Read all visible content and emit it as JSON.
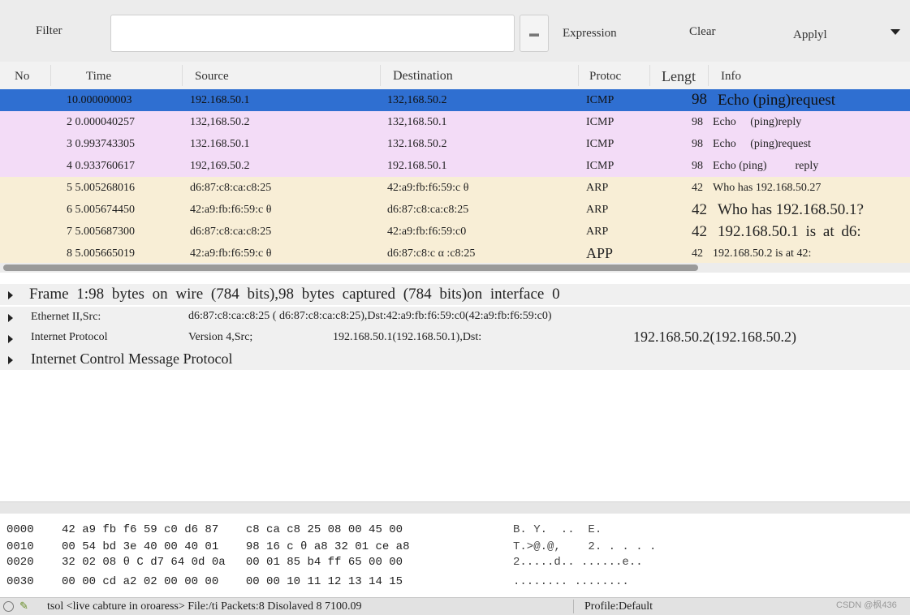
{
  "toolbar": {
    "filter_label": "Filter",
    "filter_value": "",
    "dropdown_glyph": "▬",
    "expression_label": "Expression",
    "clear_label": "Clear",
    "apply_label": "Applyl"
  },
  "columns": {
    "no": "No",
    "time": "Time",
    "source": "Source",
    "destination": "Destination",
    "protocol": "Protoc",
    "length": "Lengt",
    "info": "Info"
  },
  "packets": [
    {
      "no_time": "10.000000003",
      "source": "192.168.50.1",
      "destination": "132,168.50.2",
      "protocol": "ICMP",
      "length": "98",
      "info": "Echo (ping)request"
    },
    {
      "no_time": "2 0.000040257",
      "source": "132,168.50.2",
      "destination": "132,168.50.1",
      "protocol": "ICMP",
      "length": "98",
      "info": "Echo     (ping)reply"
    },
    {
      "no_time": "3 0.993743305",
      "source": "132.168.50.1",
      "destination": "132.168.50.2",
      "protocol": "ICMP",
      "length": "98",
      "info": "Echo     (ping)request"
    },
    {
      "no_time": "4 0.933760617",
      "source": "192,169.50.2",
      "destination": "192.168.50.1",
      "protocol": "ICMP",
      "length": "98",
      "info": "Echo (ping)          reply"
    },
    {
      "no_time": "5 5.005268016",
      "source": "d6:87:c8:ca:c8:25",
      "destination": "42:a9:fb:f6:59:c θ",
      "protocol": "ARP",
      "length": "42",
      "info": "Who has 192.168.50.27"
    },
    {
      "no_time": "6 5.005674450",
      "source": "42:a9:fb:f6:59:c θ",
      "destination": "d6:87:c8:ca:c8:25",
      "protocol": "ARP",
      "length": "42",
      "info": "Who has 192.168.50.1?"
    },
    {
      "no_time": "7 5.005687300",
      "source": "d6:87:c8:ca:c8:25",
      "destination": "42:a9:fb:f6:59:c0",
      "protocol": "ARP",
      "length": "42",
      "info": "192.168.50.1 is at d6:"
    },
    {
      "no_time": "8 5.005665019",
      "source": "42:a9:fb:f6:59:c θ",
      "destination": "d6:87:c8:c α :c8:25",
      "protocol": "APP",
      "length": "42",
      "info": "192.168.50.2 is at 42:"
    }
  ],
  "details": {
    "frame": "Frame 1:98 bytes on wire (784 bits),98 bytes captured (784 bits)on interface 0",
    "ethernet_label": "Ethernet II,Src:",
    "ethernet_value": "d6:87:c8:ca:c8:25 ( d6:87:c8:ca:c8:25),Dst:42:a9:fb:f6:59:c0(42:a9:fb:f6:59:c0)",
    "ip_label": "Internet Protocol",
    "ip_version": "Version 4,Src;",
    "ip_src": "192.168.50.1(192.168.50.1),Dst:",
    "ip_dst": "192.168.50.2(192.168.50.2)",
    "icmp": "Internet Control Message Protocol"
  },
  "hex": [
    {
      "offset": "0000",
      "bytes": "42 a9 fb f6 59 c0 d6 87    c8 ca c8 25 08 00 45 00",
      "ascii": "B. Y.  ..  E."
    },
    {
      "offset": "0010",
      "bytes": "00 54 bd 3e 40 00 40 01    98 16 c θ a8 32 01 ce a8",
      "ascii": "T.>@.@,    2. . . . ."
    },
    {
      "offset": "0020",
      "bytes": "32 02 08 θ C d7 64 0d 0a   00 01 85 b4 ff 65 00 00",
      "ascii": "2.....d.. ......e.."
    },
    {
      "offset": "0030",
      "bytes": "00 00 cd a2 02 00 00 00    00 00 10 11 12 13 14 15",
      "ascii": "........ ........"
    }
  ],
  "status": {
    "left": "tsol  <live cabture in oroaress> File:/ti Packets:8 Disolaved 8 7100.09",
    "profile": "Profile:Default"
  },
  "watermark": "CSDN @枫436",
  "colors": {
    "selected_row": "#2f6fd1",
    "icmp_row": "#f3dcf7",
    "arp_row": "#f8eed6"
  }
}
